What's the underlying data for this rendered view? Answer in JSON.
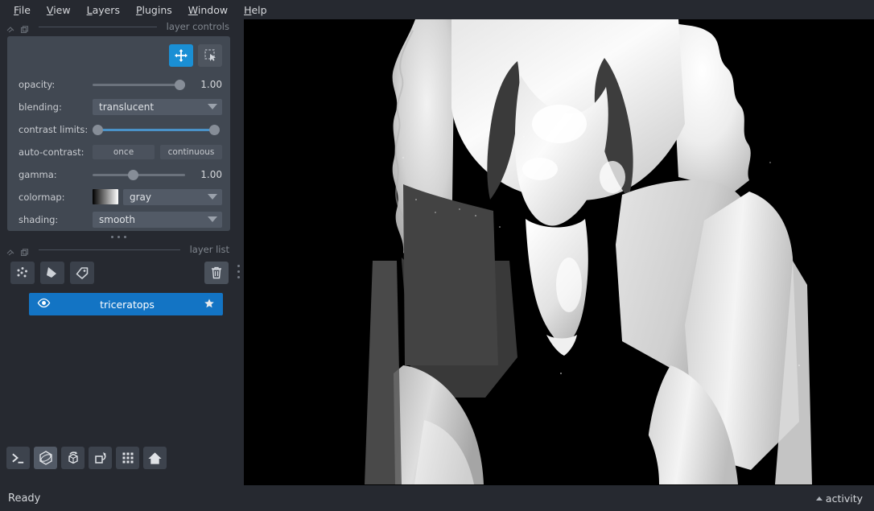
{
  "menubar": {
    "items": [
      {
        "label": "File",
        "accel": "F"
      },
      {
        "label": "View",
        "accel": "V"
      },
      {
        "label": "Layers",
        "accel": "L"
      },
      {
        "label": "Plugins",
        "accel": "P"
      },
      {
        "label": "Window",
        "accel": "W"
      },
      {
        "label": "Help",
        "accel": "H"
      }
    ]
  },
  "layer_controls": {
    "dock_title": "layer controls",
    "mode_buttons": [
      {
        "name": "pan-zoom",
        "icon": "move-icon",
        "active": true
      },
      {
        "name": "transform",
        "icon": "transform-icon",
        "active": false
      }
    ],
    "opacity": {
      "label": "opacity:",
      "value": "1.00",
      "fraction": 1.0
    },
    "blending": {
      "label": "blending:",
      "value": "translucent"
    },
    "contrast_limits": {
      "label": "contrast limits:",
      "low_fraction": 0.0,
      "high_fraction": 1.0
    },
    "auto_contrast": {
      "label": "auto-contrast:",
      "once": "once",
      "continuous": "continuous"
    },
    "gamma": {
      "label": "gamma:",
      "value": "1.00",
      "fraction": 0.38
    },
    "colormap": {
      "label": "colormap:",
      "value": "gray",
      "swatch_from": "#000000",
      "swatch_to": "#ffffff"
    },
    "shading": {
      "label": "shading:",
      "value": "smooth"
    }
  },
  "layer_list": {
    "dock_title": "layer list",
    "buttons": [
      {
        "name": "new-points-layer",
        "icon": "points-icon"
      },
      {
        "name": "new-shapes-layer",
        "icon": "shapes-icon"
      },
      {
        "name": "new-labels-layer",
        "icon": "labels-icon"
      },
      {
        "name": "delete-layer",
        "icon": "trash-icon"
      }
    ],
    "layers": [
      {
        "name": "triceratops",
        "visible": true,
        "selected": true,
        "thumbnail": "star-icon"
      }
    ]
  },
  "viewer_buttons": [
    {
      "name": "console",
      "icon": "console-icon",
      "active": false
    },
    {
      "name": "ndisplay-toggle",
      "icon": "cube-3d-icon",
      "active": true
    },
    {
      "name": "roll-dimensions",
      "icon": "roll-cube-icon",
      "active": false
    },
    {
      "name": "transpose-dimensions",
      "icon": "transpose-icon",
      "active": false
    },
    {
      "name": "grid-view",
      "icon": "grid-icon",
      "active": false
    },
    {
      "name": "reset-view",
      "icon": "home-icon",
      "active": false
    }
  ],
  "canvas": {
    "background": "#000000",
    "content": "triceratops 3d surface mesh, grayscale smooth shading, close-up of head and forelimbs"
  },
  "statusbar": {
    "status": "Ready",
    "activity": "activity"
  },
  "theme": {
    "background": "#262930",
    "panel": "#414852",
    "accent": "#1a8fd4",
    "selection": "#1374c4",
    "text": "#d6d8dc",
    "muted_text": "#81878f"
  }
}
